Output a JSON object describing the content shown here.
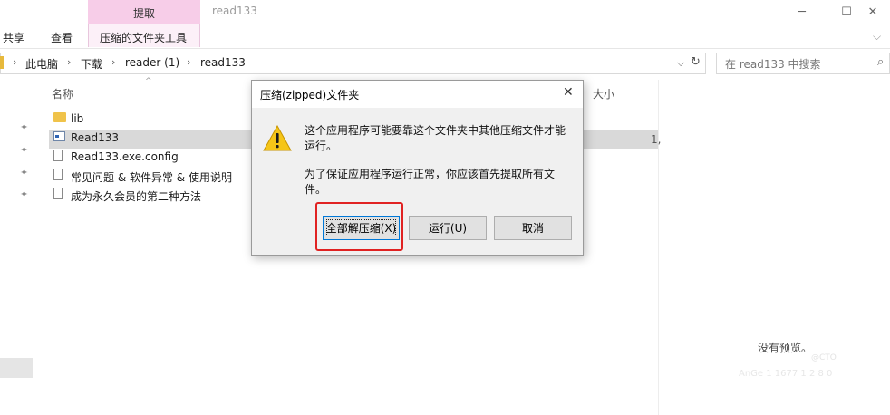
{
  "window": {
    "title": "read133",
    "controls": {
      "minimize": "─",
      "maximize": "☐",
      "close": "✕"
    }
  },
  "ribbon": {
    "contextual_tab": "提取",
    "tabs": [
      "共享",
      "查看",
      "压缩的文件夹工具"
    ],
    "collapse_chevron": "⌵"
  },
  "address": {
    "breadcrumbs": [
      "此电脑",
      "下载",
      "reader (1)",
      "read133"
    ],
    "separator": "›",
    "dropdown": "⌵",
    "refresh": "↻",
    "search_placeholder": "在 read133 中搜索",
    "search_icon": "⌕"
  },
  "nav": {
    "pin_icon": "✦"
  },
  "file_list": {
    "columns": {
      "name": "名称",
      "size": "大小"
    },
    "sort_arrow": "^",
    "items": [
      {
        "name": "lib",
        "icon": "folder-icon",
        "selected": false,
        "size": ""
      },
      {
        "name": "Read133",
        "icon": "exe-icon",
        "selected": true,
        "size": "1,"
      },
      {
        "name": "Read133.exe.config",
        "icon": "document-icon",
        "selected": false,
        "size": ""
      },
      {
        "name": "常见问题 & 软件异常 & 使用说明",
        "icon": "document-icon",
        "selected": false,
        "size": ""
      },
      {
        "name": "成为永久会员的第二种方法",
        "icon": "document-icon",
        "selected": false,
        "size": ""
      }
    ]
  },
  "preview": {
    "text": "没有预览。"
  },
  "watermark": {
    "line1": "@CTO",
    "line2": "AnGe 1 1677 1 2 8 0"
  },
  "dialog": {
    "title": "压缩(zipped)文件夹",
    "close": "✕",
    "icon": "warning-icon",
    "message_line1": "这个应用程序可能要靠这个文件夹中其他压缩文件才能",
    "message_line2": "运行。",
    "message_line3": "为了保证应用程序运行正常，你应该首先提取所有文",
    "message_line4": "件。",
    "buttons": {
      "extract_all": "全部解压缩(X)",
      "run": "运行(U)",
      "cancel": "取消"
    },
    "highlight_color": "#e02222"
  }
}
